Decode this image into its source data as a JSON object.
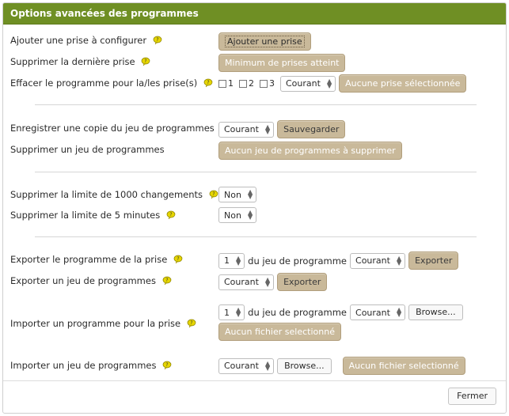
{
  "dialog": {
    "title": "Options avancées des programmes",
    "close_label": "Fermer"
  },
  "rows": {
    "add_outlet": {
      "label": "Ajouter une prise à configurer",
      "button": "Ajouter une prise"
    },
    "remove_last": {
      "label": "Supprimer la dernière prise",
      "button": "Minimum de prises atteint"
    },
    "clear_program": {
      "label": "Effacer le programme pour la/les prise(s)",
      "checkboxes": [
        "1",
        "2",
        "3"
      ],
      "select_value": "Courant",
      "button": "Aucune prise sélectionnée"
    },
    "save_copy": {
      "label": "Enregistrer une copie du jeu de programmes",
      "select_value": "Courant",
      "button": "Sauvegarder"
    },
    "delete_set": {
      "label": "Supprimer un jeu de programmes",
      "button": "Aucun jeu de programmes à supprimer"
    },
    "limit_changes": {
      "label": "Supprimer la limite de 1000 changements",
      "select_value": "Non"
    },
    "limit_minutes": {
      "label": "Supprimer la limite de 5 minutes",
      "select_value": "Non"
    },
    "export_program": {
      "label": "Exporter le programme de la prise",
      "outlet_value": "1",
      "middle_text": "du jeu de programme",
      "set_value": "Courant",
      "button": "Exporter"
    },
    "export_set": {
      "label": "Exporter un jeu de programmes",
      "select_value": "Courant",
      "button": "Exporter"
    },
    "import_program": {
      "label": "Importer un programme pour la prise",
      "outlet_value": "1",
      "middle_text": "du jeu de programme",
      "set_value": "Courant",
      "browse": "Browse...",
      "file_status": "Aucun fichier selectionné"
    },
    "import_set": {
      "label": "Importer un jeu de programmes",
      "select_value": "Courant",
      "browse": "Browse...",
      "file_status": "Aucun fichier selectionné"
    }
  },
  "colors": {
    "titlebar": "#6f8f24",
    "tan_button": "#c9b99a",
    "hint_icon": "#e6d600"
  }
}
